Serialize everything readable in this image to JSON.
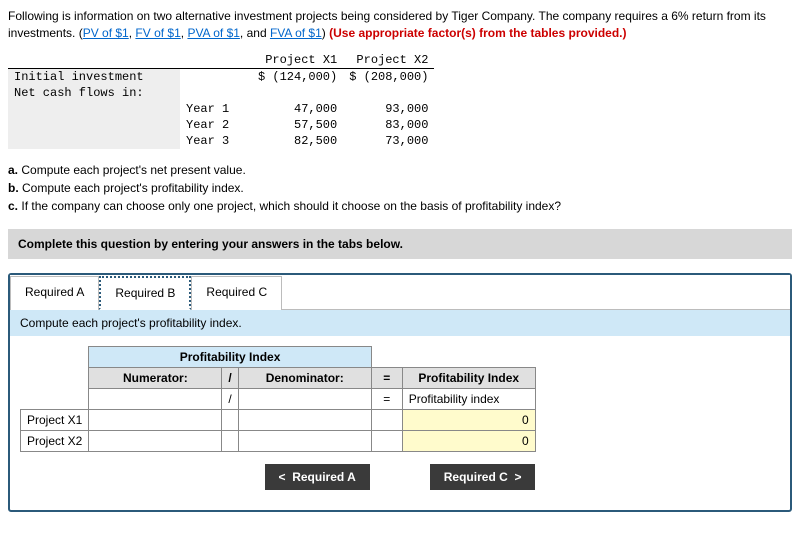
{
  "intro": {
    "pre": "Following is information on two alternative investment projects being considered by Tiger Company. The company requires a 6% return from its investments. (",
    "links": [
      "PV of $1",
      "FV of $1",
      "PVA of $1",
      "FVA of $1"
    ],
    "sep": ", ",
    "and": ", and ",
    "post": ") ",
    "red": "(Use appropriate factor(s) from the tables provided.)"
  },
  "dataTable": {
    "cols": [
      "",
      "",
      "Project X1",
      "Project X2"
    ],
    "rows": [
      [
        "Initial investment",
        "",
        "$ (124,000)",
        "$ (208,000)"
      ],
      [
        "Net cash flows in:",
        "",
        "",
        ""
      ],
      [
        "",
        "Year 1",
        "47,000",
        "93,000"
      ],
      [
        "",
        "Year 2",
        "57,500",
        "83,000"
      ],
      [
        "",
        "Year 3",
        "82,500",
        "73,000"
      ]
    ]
  },
  "questions": {
    "a": "Compute each project's net present value.",
    "b": "Compute each project's profitability index.",
    "c": "If the company can choose only one project, which should it choose on the basis of profitability index?"
  },
  "completeBar": "Complete this question by entering your answers in the tabs below.",
  "tabs": {
    "a": "Required A",
    "b": "Required B",
    "c": "Required C"
  },
  "subBar": "Compute each project's profitability index.",
  "piTable": {
    "topHeader": "Profitability Index",
    "numerator": "Numerator:",
    "slash": "/",
    "denominator": "Denominator:",
    "eq": "=",
    "resultHeader": "Profitability Index",
    "resultLabel": "Profitability index",
    "rowLabels": [
      "Project X1",
      "Project X2"
    ],
    "zero": "0"
  },
  "nav": {
    "prev": "Required A",
    "next": "Required C"
  }
}
